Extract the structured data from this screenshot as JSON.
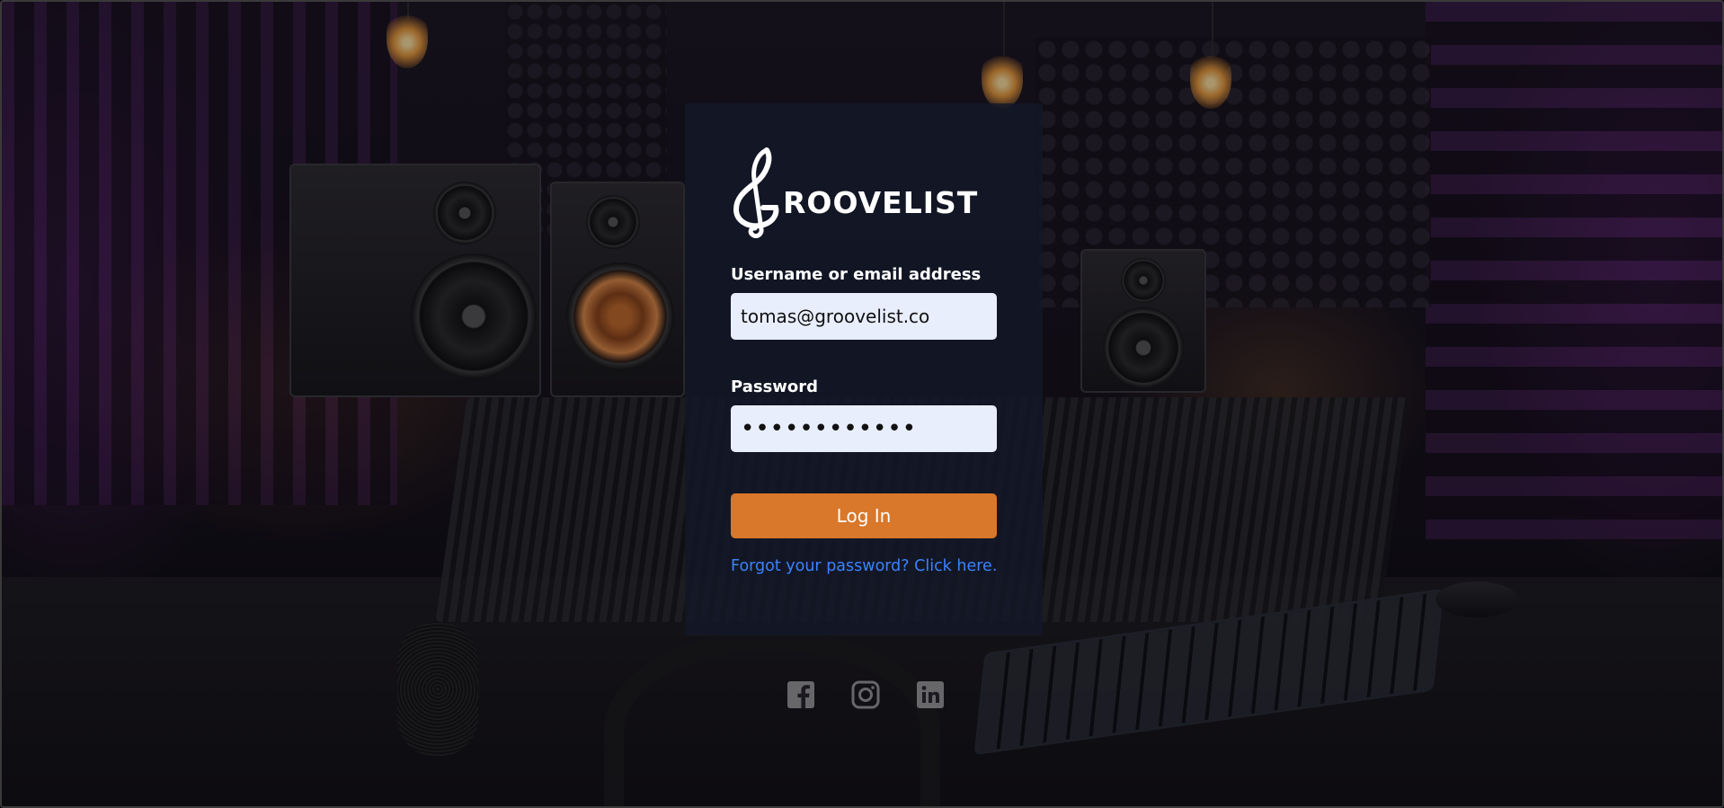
{
  "brand": {
    "name": "ROOVELIST",
    "logo_icon": "treble-clef-g-icon"
  },
  "login_form": {
    "username_label": "Username or email address",
    "username_value": "tomas@groovelist.co",
    "password_label": "Password",
    "password_value": "••••••••••••",
    "login_button_label": "Log In",
    "forgot_password_link": "Forgot your password? Click here."
  },
  "social_links": [
    {
      "icon": "facebook-icon"
    },
    {
      "icon": "instagram-icon"
    },
    {
      "icon": "linkedin-icon"
    }
  ],
  "colors": {
    "accent": "#d9772a",
    "link": "#3b82ff",
    "input_bg": "#e8eefc",
    "card_bg": "#141828"
  }
}
